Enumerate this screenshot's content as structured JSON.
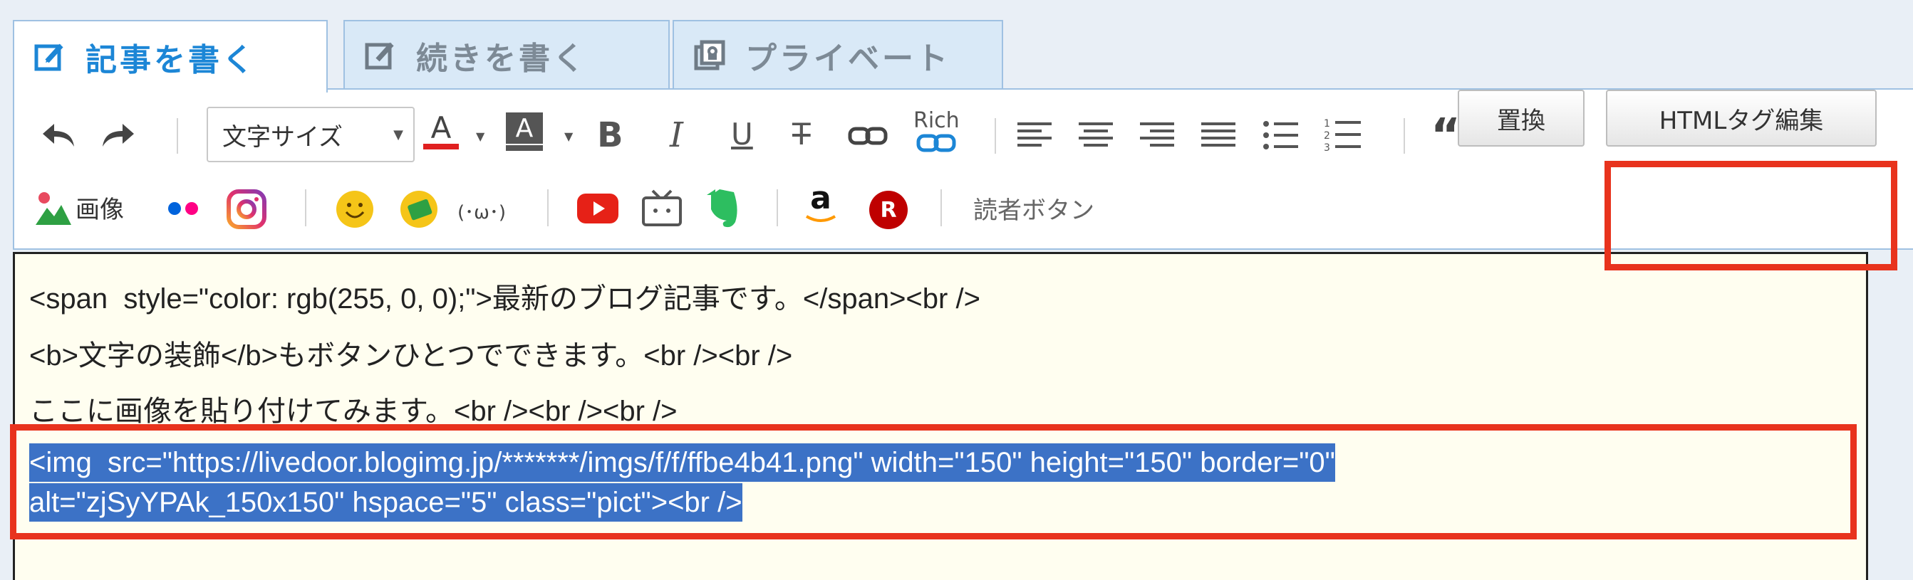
{
  "tabs": [
    {
      "label": "記事を書く",
      "icon": "pencil-square-icon",
      "active": true
    },
    {
      "label": "続きを書く",
      "icon": "pencil-square-icon",
      "active": false
    },
    {
      "label": "プライベート",
      "icon": "lock-box-icon",
      "active": false
    }
  ],
  "toolbar": {
    "font_size_label": "文字サイズ",
    "bold": "B",
    "italic": "I",
    "underline": "U",
    "strike": "T",
    "rich_label": "Rich",
    "image_label": "画像",
    "reader_button": "読者ボタン",
    "replace_button": "置換",
    "html_button": "HTMLタグ編集",
    "kaomoji": "(･ω･)",
    "amazon": "a",
    "rakuten": "R"
  },
  "editor": {
    "line1": "<span  style=\"color: rgb(255, 0, 0);\">最新のブログ記事です。</span><br />",
    "line2": "<b>文字の装飾</b>もボタンひとつでできます。<br /><br />",
    "line3": "ここに画像を貼り付けてみます。<br /><br /><br />",
    "selected_line1": "<img  src=\"https://livedoor.blogimg.jp/*******/imgs/f/f/ffbe4b41.png\" width=\"150\" height=\"150\" border=\"0\"",
    "selected_line2": "alt=\"zjSyYPAk_150x150\" hspace=\"5\" class=\"pict\"><br />"
  },
  "colors": {
    "accent": "#1c86d6",
    "highlight": "#e8331d",
    "selection": "#3c72c6",
    "editor_bg": "#fffef0"
  }
}
